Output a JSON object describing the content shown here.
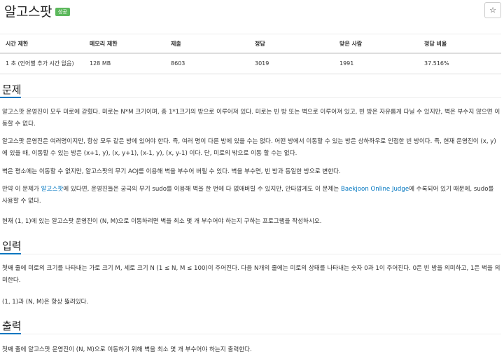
{
  "header": {
    "title": "알고스팟",
    "badge": "성공",
    "star": "☆"
  },
  "info_table": {
    "headers": [
      "시간 제한",
      "메모리 제한",
      "제출",
      "정답",
      "맞은 사람",
      "정답 비율"
    ],
    "row": [
      "1 초 (언어별 추가 시간 없음)",
      "128 MB",
      "8603",
      "3019",
      "1991",
      "37.516%"
    ]
  },
  "problem": {
    "title": "문제",
    "p1": "알고스팟 운영진이 모두 미로에 갇혔다. 미로는 N*M 크기이며, 총 1*1크기의 방으로 이루어져 있다. 미로는 빈 방 또는 벽으로 이루어져 있고, 빈 방은 자유롭게 다닐 수 있지만, 벽은 부수지 않으면 이동할 수 없다.",
    "p2": "알고스팟 운영진은 여러명이지만, 항상 모두 같은 방에 있어야 한다. 즉, 여러 명이 다른 방에 있을 수는 없다. 어떤 방에서 이동할 수 있는 방은 상하좌우로 인접한 빈 방이다. 즉, 현재 운영진이 (x, y)에 있을 때, 이동할 수 있는 방은 (x+1, y), (x, y+1), (x-1, y), (x, y-1) 이다. 단, 미로의 밖으로 이동 할 수는 없다.",
    "p3": "벽은 평소에는 이동할 수 없지만, 알고스팟의 무기 AOJ를 이용해 벽을 부수어 버릴 수 있다. 벽을 부수면, 빈 방과 동일한 방으로 변한다.",
    "p4_a": "만약 이 문제가 ",
    "p4_link1": "알고스팟",
    "p4_b": "에 있다면, 운영진들은 궁극의 무기 sudo를 이용해 벽을 한 번에 다 없애버릴 수 있지만, 안타깝게도 이 문제는 ",
    "p4_link2": "Baekjoon Online Judge",
    "p4_c": "에 수록되어 있기 때문에, sudo를 사용할 수 없다.",
    "p5": "현재 (1, 1)에 있는 알고스팟 운영진이 (N, M)으로 이동하려면 벽을 최소 몇 개 부수어야 하는지 구하는 프로그램을 작성하시오."
  },
  "input": {
    "title": "입력",
    "p1": "첫째 줄에 미로의 크기를 나타내는 가로 크기 M, 세로 크기 N (1 ≤ N, M ≤ 100)이 주어진다. 다음 N개의 줄에는 미로의 상태를 나타내는 숫자 0과 1이 주어진다. 0은 빈 방을 의미하고, 1은 벽을 의미한다.",
    "p2": "(1, 1)과 (N, M)은 항상 뚫려있다."
  },
  "output": {
    "title": "출력",
    "p1": "첫째 줄에 알고스팟 운영진이 (N, M)으로 이동하기 위해 벽을 최소 몇 개 부수어야 하는지 출력한다."
  },
  "colors": {
    "accent": "#0076c0",
    "badge": "#5cb85c"
  }
}
